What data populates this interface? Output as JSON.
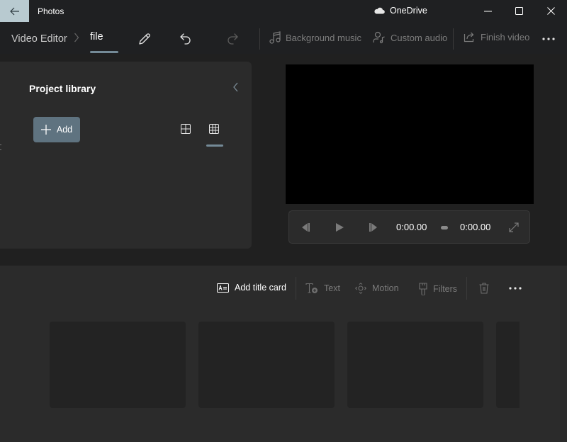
{
  "titlebar": {
    "app_title": "Photos",
    "back_icon": "arrow-left-icon",
    "onedrive_label": "OneDrive",
    "onedrive_icon": "cloud-icon",
    "window_controls": [
      "minimize",
      "maximize",
      "close"
    ]
  },
  "commandbar": {
    "breadcrumb_root": "Video Editor",
    "breadcrumb_current": "file",
    "actions": {
      "rename_icon": "pencil-icon",
      "undo_icon": "undo-icon",
      "redo_icon": "redo-icon",
      "background_music": "Background music",
      "custom_audio": "Custom audio",
      "finish_video": "Finish video",
      "more_icon": "more-horizontal-icon"
    }
  },
  "library": {
    "title": "Project library",
    "add_label": "Add",
    "views": [
      "large-grid",
      "small-grid"
    ],
    "selected_view": "small-grid"
  },
  "player": {
    "current_time": "0:00.00",
    "total_time": "0:00.00"
  },
  "storyboard": {
    "add_title_card": "Add title card",
    "text": "Text",
    "motion": "Motion",
    "filters": "Filters",
    "delete_icon": "trash-icon",
    "more_icon": "more-horizontal-icon",
    "clip_count_visible": 4
  },
  "colors": {
    "accent": "#748a97",
    "add_button": "#5f7380",
    "back_button": "#b8cad0",
    "chrome_bg": "#1f2022",
    "panel_bg": "#2b2b2b"
  }
}
